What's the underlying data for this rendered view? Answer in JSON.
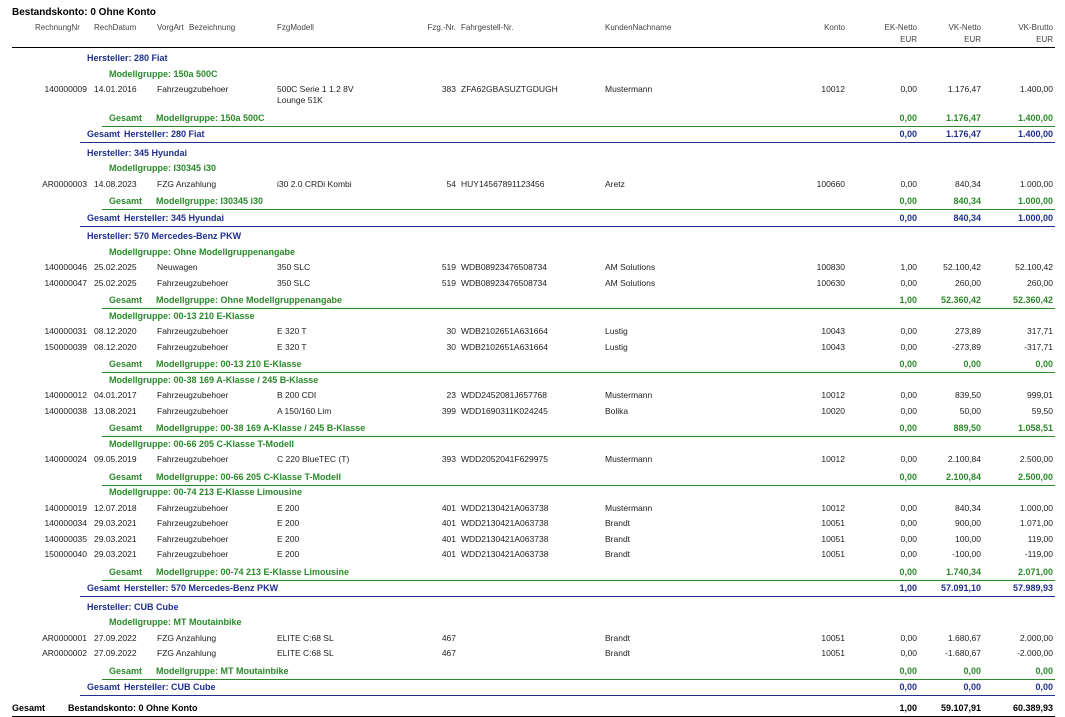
{
  "title": "Bestandskonto: 0 Ohne Konto",
  "headers": {
    "rechnungnr": "RechnungNr",
    "rechdatum": "RechDatum",
    "vorgart": "VorgArt",
    "bezeichnung": "Bezeichnung",
    "fzgmodell": "FzgModell",
    "fzgnr": "Fzg.-Nr.",
    "fahrgestell": "Fahrgestell-Nr.",
    "kunde": "KundenNachname",
    "konto": "Konto",
    "ek": "EK-Netto",
    "vkn": "VK-Netto",
    "vkb": "VK-Brutto",
    "eur": "EUR"
  },
  "manufacturers": [
    {
      "label": "Hersteller: 280 Fiat",
      "groups": [
        {
          "label": "Modellgruppe: 150a 500C",
          "rows": [
            {
              "nr": "140000009",
              "datum": "14.01.2016",
              "art": "Fahrzeugzubehoer",
              "modell": "500C Serie 1 1.2 8V",
              "modell2": "Lounge 51K",
              "fzg": "383",
              "fgst": "ZFA62GBASUZTGDUGH",
              "kunde": "Mustermann",
              "konto": "10012",
              "ek": "0,00",
              "vkn": "1.176,47",
              "vkb": "1.400,00"
            }
          ],
          "sum": {
            "label": "Modellgruppe: 150a 500C",
            "ek": "0,00",
            "vkn": "1.176,47",
            "vkb": "1.400,00"
          }
        }
      ],
      "sum": {
        "label": "Hersteller: 280 Fiat",
        "ek": "0,00",
        "vkn": "1.176,47",
        "vkb": "1.400,00"
      }
    },
    {
      "label": "Hersteller: 345 Hyundai",
      "groups": [
        {
          "label": "Modellgruppe: I30345 i30",
          "rows": [
            {
              "nr": "AR0000003",
              "datum": "14.08.2023",
              "art": "FZG Anzahlung",
              "modell": "i30 2.0 CRDi Kombi",
              "fzg": "54",
              "fgst": "HUY14567891123456",
              "kunde": "Aretz",
              "konto": "100660",
              "ek": "0,00",
              "vkn": "840,34",
              "vkb": "1.000,00"
            }
          ],
          "sum": {
            "label": "Modellgruppe: I30345 i30",
            "ek": "0,00",
            "vkn": "840,34",
            "vkb": "1.000,00"
          }
        }
      ],
      "sum": {
        "label": "Hersteller: 345 Hyundai",
        "ek": "0,00",
        "vkn": "840,34",
        "vkb": "1.000,00"
      }
    },
    {
      "label": "Hersteller: 570 Mercedes-Benz PKW",
      "groups": [
        {
          "label": "Modellgruppe: Ohne Modellgruppenangabe",
          "rows": [
            {
              "nr": "140000046",
              "datum": "25.02.2025",
              "art": "Neuwagen",
              "modell": "350 SLC",
              "fzg": "519",
              "fgst": "WDB08923476508734",
              "kunde": "AM Solutions",
              "konto": "100830",
              "ek": "1,00",
              "vkn": "52.100,42",
              "vkb": "52.100,42"
            },
            {
              "nr": "140000047",
              "datum": "25.02.2025",
              "art": "Fahrzeugzubehoer",
              "modell": "350 SLC",
              "fzg": "519",
              "fgst": "WDB08923476508734",
              "kunde": "AM Solutions",
              "konto": "100630",
              "ek": "0,00",
              "vkn": "260,00",
              "vkb": "260,00"
            }
          ],
          "sum": {
            "label": "Modellgruppe: Ohne Modellgruppenangabe",
            "ek": "1,00",
            "vkn": "52.360,42",
            "vkb": "52.360,42"
          }
        },
        {
          "label": "Modellgruppe: 00-13 210 E-Klasse",
          "rows": [
            {
              "nr": "140000031",
              "datum": "08.12.2020",
              "art": "Fahrzeugzubehoer",
              "modell": "E 320 T",
              "fzg": "30",
              "fgst": "WDB2102651A631664",
              "kunde": "Lustig",
              "konto": "10043",
              "ek": "0,00",
              "vkn": "273,89",
              "vkb": "317,71"
            },
            {
              "nr": "150000039",
              "datum": "08.12.2020",
              "art": "Fahrzeugzubehoer",
              "modell": "E 320 T",
              "fzg": "30",
              "fgst": "WDB2102651A631664",
              "kunde": "Lustig",
              "konto": "10043",
              "ek": "0,00",
              "vkn": "-273,89",
              "vkb": "-317,71"
            }
          ],
          "sum": {
            "label": "Modellgruppe: 00-13 210 E-Klasse",
            "ek": "0,00",
            "vkn": "0,00",
            "vkb": "0,00"
          }
        },
        {
          "label": "Modellgruppe: 00-38 169 A-Klasse / 245 B-Klasse",
          "rows": [
            {
              "nr": "140000012",
              "datum": "04.01.2017",
              "art": "Fahrzeugzubehoer",
              "modell": "B 200 CDI",
              "fzg": "23",
              "fgst": "WDD2452081J657768",
              "kunde": "Mustermann",
              "konto": "10012",
              "ek": "0,00",
              "vkn": "839,50",
              "vkb": "999,01"
            },
            {
              "nr": "140000038",
              "datum": "13.08.2021",
              "art": "Fahrzeugzubehoer",
              "modell": "A 150/160 Lim",
              "fzg": "399",
              "fgst": "WDD1690311K024245",
              "kunde": "Bolika",
              "konto": "10020",
              "ek": "0,00",
              "vkn": "50,00",
              "vkb": "59,50"
            }
          ],
          "sum": {
            "label": "Modellgruppe: 00-38 169 A-Klasse / 245 B-Klasse",
            "ek": "0,00",
            "vkn": "889,50",
            "vkb": "1.058,51"
          }
        },
        {
          "label": "Modellgruppe: 00-66 205 C-Klasse T-Modell",
          "rows": [
            {
              "nr": "140000024",
              "datum": "09.05.2019",
              "art": "Fahrzeugzubehoer",
              "modell": "C 220 BlueTEC (T)",
              "fzg": "393",
              "fgst": "WDD2052041F629975",
              "kunde": "Mustermann",
              "konto": "10012",
              "ek": "0,00",
              "vkn": "2.100,84",
              "vkb": "2.500,00"
            }
          ],
          "sum": {
            "label": "Modellgruppe: 00-66 205 C-Klasse T-Modell",
            "ek": "0,00",
            "vkn": "2.100,84",
            "vkb": "2.500,00"
          }
        },
        {
          "label": "Modellgruppe: 00-74 213 E-Klasse Limousine",
          "rows": [
            {
              "nr": "140000019",
              "datum": "12.07.2018",
              "art": "Fahrzeugzubehoer",
              "modell": "E 200",
              "fzg": "401",
              "fgst": "WDD2130421A063738",
              "kunde": "Mustermann",
              "konto": "10012",
              "ek": "0,00",
              "vkn": "840,34",
              "vkb": "1.000,00"
            },
            {
              "nr": "140000034",
              "datum": "29.03.2021",
              "art": "Fahrzeugzubehoer",
              "modell": "E 200",
              "fzg": "401",
              "fgst": "WDD2130421A063738",
              "kunde": "Brandt",
              "konto": "10051",
              "ek": "0,00",
              "vkn": "900,00",
              "vkb": "1.071,00"
            },
            {
              "nr": "140000035",
              "datum": "29.03.2021",
              "art": "Fahrzeugzubehoer",
              "modell": "E 200",
              "fzg": "401",
              "fgst": "WDD2130421A063738",
              "kunde": "Brandt",
              "konto": "10051",
              "ek": "0,00",
              "vkn": "100,00",
              "vkb": "119,00"
            },
            {
              "nr": "150000040",
              "datum": "29.03.2021",
              "art": "Fahrzeugzubehoer",
              "modell": "E 200",
              "fzg": "401",
              "fgst": "WDD2130421A063738",
              "kunde": "Brandt",
              "konto": "10051",
              "ek": "0,00",
              "vkn": "-100,00",
              "vkb": "-119,00"
            }
          ],
          "sum": {
            "label": "Modellgruppe: 00-74 213 E-Klasse Limousine",
            "ek": "0,00",
            "vkn": "1.740,34",
            "vkb": "2.071,00"
          }
        }
      ],
      "sum": {
        "label": "Hersteller: 570 Mercedes-Benz PKW",
        "ek": "1,00",
        "vkn": "57.091,10",
        "vkb": "57.989,93"
      }
    },
    {
      "label": "Hersteller: CUB Cube",
      "groups": [
        {
          "label": "Modellgruppe: MT Moutainbike",
          "rows": [
            {
              "nr": "AR0000001",
              "datum": "27.09.2022",
              "art": "FZG Anzahlung",
              "modell": "ELITE C:68 SL",
              "fzg": "467",
              "fgst": "",
              "kunde": "Brandt",
              "konto": "10051",
              "ek": "0,00",
              "vkn": "1.680,67",
              "vkb": "2.000,00"
            },
            {
              "nr": "AR0000002",
              "datum": "27.09.2022",
              "art": "FZG Anzahlung",
              "modell": "ELITE C:68 SL",
              "fzg": "467",
              "fgst": "",
              "kunde": "Brandt",
              "konto": "10051",
              "ek": "0,00",
              "vkn": "-1.680,67",
              "vkb": "-2.000,00"
            }
          ],
          "sum": {
            "label": "Modellgruppe: MT Moutainbike",
            "ek": "0,00",
            "vkn": "0,00",
            "vkb": "0,00"
          }
        }
      ],
      "sum": {
        "label": "Hersteller: CUB Cube",
        "ek": "0,00",
        "vkn": "0,00",
        "vkb": "0,00"
      }
    }
  ],
  "gesamt_word": "Gesamt",
  "grand_total": {
    "label": "Bestandskonto: 0 Ohne Konto",
    "ek": "1,00",
    "vkn": "59.107,91",
    "vkb": "60.389,93"
  }
}
